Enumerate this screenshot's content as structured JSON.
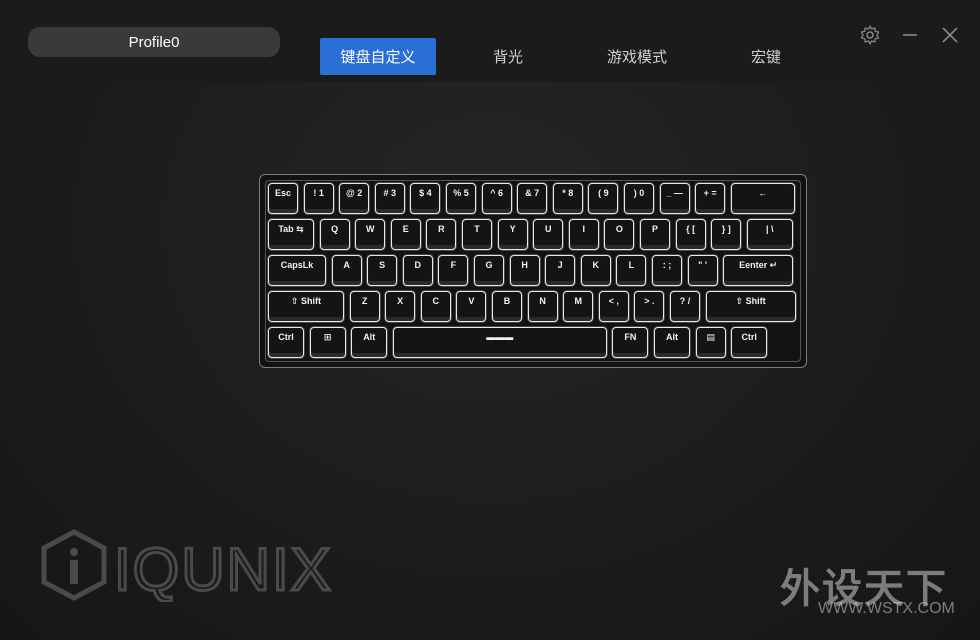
{
  "profile": {
    "name": "Profile0"
  },
  "tabs": [
    {
      "label": "键盘自定义",
      "active": true
    },
    {
      "label": "背光",
      "active": false
    },
    {
      "label": "游戏模式",
      "active": false
    },
    {
      "label": "宏键",
      "active": false
    }
  ],
  "window_controls": [
    {
      "name": "settings",
      "icon": "gear-icon"
    },
    {
      "name": "minimize",
      "icon": "minimize-icon"
    },
    {
      "name": "close",
      "icon": "close-icon"
    }
  ],
  "accent_color": "#2a6fd6",
  "keyboard": {
    "rows": [
      [
        "Esc",
        "! 1",
        "@ 2",
        "# 3",
        "$ 4",
        "% 5",
        "^ 6",
        "& 7",
        "* 8",
        "( 9",
        ") 0",
        "_ —",
        "+ =",
        "←"
      ],
      [
        "Tab ⇆",
        "Q",
        "W",
        "E",
        "R",
        "T",
        "Y",
        "U",
        "I",
        "O",
        "P",
        "{ [",
        "} ]",
        "| \\"
      ],
      [
        "CapsLk",
        "A",
        "S",
        "D",
        "F",
        "G",
        "H",
        "J",
        "K",
        "L",
        ": ;",
        "\" '",
        "Eenter ↵"
      ],
      [
        "⇧ Shift",
        "Z",
        "X",
        "C",
        "V",
        "B",
        "N",
        "M",
        "< ,",
        "> .",
        "? /",
        "⇧ Shift"
      ],
      [
        "Ctrl",
        "⊞",
        "Alt",
        "▬▬▬",
        "FN",
        "Alt",
        "▤",
        "Ctrl"
      ]
    ]
  },
  "brand": {
    "logo_text": "IQUNIX"
  },
  "watermark": {
    "text": "外设天下",
    "url": "WWW.WSTX.COM"
  }
}
